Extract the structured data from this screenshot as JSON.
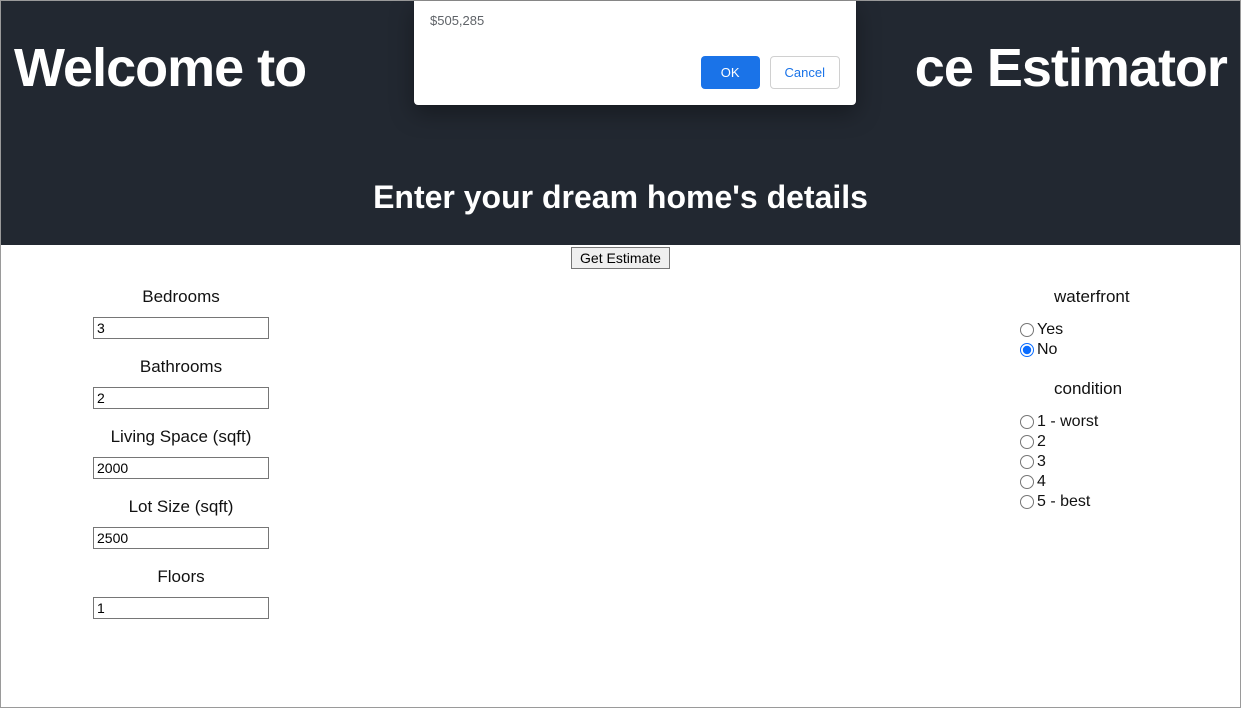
{
  "header": {
    "title_visible_left": "Welcome to",
    "title_visible_right": "ce Estimator",
    "subtitle": "Enter your dream home's details"
  },
  "actions": {
    "estimate_label": "Get Estimate"
  },
  "form": {
    "bedrooms_label": "Bedrooms",
    "bedrooms_value": "3",
    "bathrooms_label": "Bathrooms",
    "bathrooms_value": "2",
    "living_label": "Living Space (sqft)",
    "living_value": "2000",
    "lot_label": "Lot Size (sqft)",
    "lot_value": "2500",
    "floors_label": "Floors",
    "floors_value": "1"
  },
  "waterfront": {
    "label": "waterfront",
    "options": [
      "Yes",
      "No"
    ],
    "selected": "No"
  },
  "condition": {
    "label": "condition",
    "options": [
      "1 - worst",
      "2",
      "3",
      "4",
      "5 - best"
    ],
    "selected": ""
  },
  "alert": {
    "message": "$505,285",
    "ok_label": "OK",
    "cancel_label": "Cancel"
  }
}
